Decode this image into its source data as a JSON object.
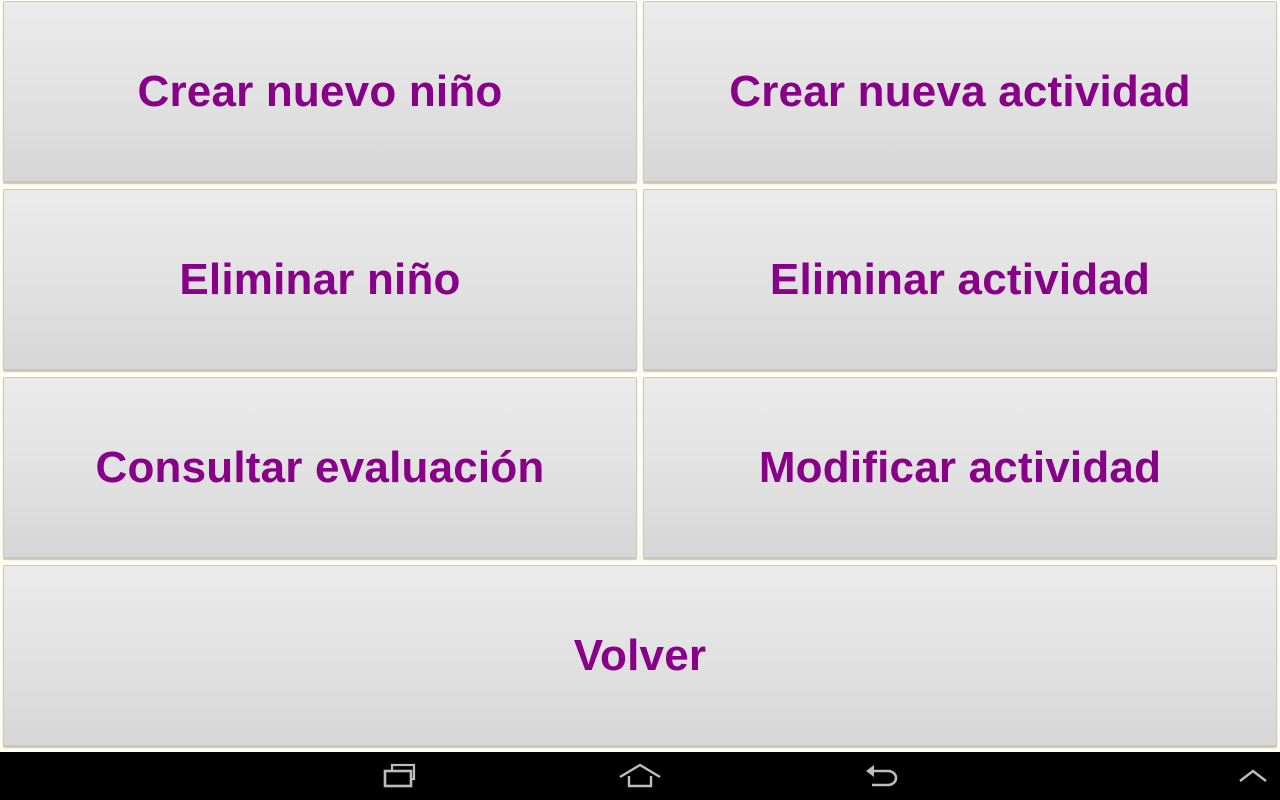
{
  "buttons": {
    "crear_nino": "Crear nuevo niño",
    "crear_actividad": "Crear nueva actividad",
    "eliminar_nino": "Eliminar niño",
    "eliminar_actividad": "Eliminar actividad",
    "consultar_evaluacion": "Consultar evaluación",
    "modificar_actividad": "Modificar actividad",
    "volver": "Volver"
  },
  "colors": {
    "button_text": "#880088",
    "navbar": "#000000",
    "background": "#fdfdf0"
  },
  "navbar": {
    "icons": [
      "recent-apps-icon",
      "home-icon",
      "back-icon",
      "chevron-up-icon"
    ]
  }
}
